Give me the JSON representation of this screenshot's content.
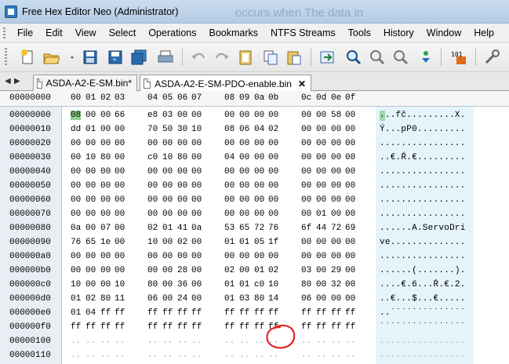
{
  "window": {
    "title": "Free Hex Editor Neo (Administrator)",
    "background_text": "occurs when          The data in"
  },
  "menu": [
    "File",
    "Edit",
    "View",
    "Select",
    "Operations",
    "Bookmarks",
    "NTFS Streams",
    "Tools",
    "History",
    "Window",
    "Help"
  ],
  "toolbar": {
    "icons": [
      "new-file-icon",
      "open-folder-icon",
      "dropdown-arrow-icon",
      "save-icon",
      "save-as-icon",
      "save-all-icon",
      "print-icon",
      "undo-icon",
      "redo-icon",
      "clipboard-icon",
      "copy-icon",
      "paste-icon",
      "go-to-icon",
      "find-icon",
      "find-next-icon",
      "find-prev-icon",
      "replace-icon",
      "encoding-icon",
      "tools-icon"
    ]
  },
  "tabs": [
    {
      "label": "ASDA-A2-E-SM.bin*",
      "active": false
    },
    {
      "label": "ASDA-A2-E-SM-PDO-enable.bin",
      "active": true
    }
  ],
  "hex": {
    "corner": "00000000",
    "columns": [
      "00",
      "01",
      "02",
      "03",
      "04",
      "05",
      "06",
      "07",
      "08",
      "09",
      "0a",
      "0b",
      "0c",
      "0d",
      "0e",
      "0f"
    ],
    "rows": [
      {
        "offset": "00000000",
        "bytes": [
          "08",
          "00",
          "00",
          "66",
          "e8",
          "03",
          "00",
          "00",
          "00",
          "00",
          "00",
          "00",
          "00",
          "00",
          "58",
          "00"
        ],
        "ascii": "...fč.........X."
      },
      {
        "offset": "00000010",
        "bytes": [
          "dd",
          "01",
          "00",
          "00",
          "70",
          "50",
          "30",
          "10",
          "08",
          "06",
          "04",
          "02",
          "00",
          "00",
          "00",
          "00"
        ],
        "ascii": "Ý...pP0........."
      },
      {
        "offset": "00000020",
        "bytes": [
          "00",
          "00",
          "00",
          "00",
          "00",
          "00",
          "00",
          "00",
          "00",
          "00",
          "00",
          "00",
          "00",
          "00",
          "00",
          "00"
        ],
        "ascii": "................"
      },
      {
        "offset": "00000030",
        "bytes": [
          "00",
          "10",
          "80",
          "00",
          "c0",
          "10",
          "80",
          "00",
          "04",
          "00",
          "00",
          "00",
          "00",
          "00",
          "00",
          "00"
        ],
        "ascii": "..€.Ŕ.€........."
      },
      {
        "offset": "00000040",
        "bytes": [
          "00",
          "00",
          "00",
          "00",
          "00",
          "00",
          "00",
          "00",
          "00",
          "00",
          "00",
          "00",
          "00",
          "00",
          "00",
          "00"
        ],
        "ascii": "................"
      },
      {
        "offset": "00000050",
        "bytes": [
          "00",
          "00",
          "00",
          "00",
          "00",
          "00",
          "00",
          "00",
          "00",
          "00",
          "00",
          "00",
          "00",
          "00",
          "00",
          "00"
        ],
        "ascii": "................"
      },
      {
        "offset": "00000060",
        "bytes": [
          "00",
          "00",
          "00",
          "00",
          "00",
          "00",
          "00",
          "00",
          "00",
          "00",
          "00",
          "00",
          "00",
          "00",
          "00",
          "00"
        ],
        "ascii": "................"
      },
      {
        "offset": "00000070",
        "bytes": [
          "00",
          "00",
          "00",
          "00",
          "00",
          "00",
          "00",
          "00",
          "00",
          "00",
          "00",
          "00",
          "00",
          "01",
          "00",
          "00"
        ],
        "ascii": "................"
      },
      {
        "offset": "00000080",
        "bytes": [
          "0a",
          "00",
          "07",
          "00",
          "02",
          "01",
          "41",
          "0a",
          "53",
          "65",
          "72",
          "76",
          "6f",
          "44",
          "72",
          "69"
        ],
        "ascii": "......A.ServoDri"
      },
      {
        "offset": "00000090",
        "bytes": [
          "76",
          "65",
          "1e",
          "00",
          "10",
          "00",
          "02",
          "00",
          "01",
          "01",
          "05",
          "1f",
          "00",
          "00",
          "00",
          "00"
        ],
        "ascii": "ve.............."
      },
      {
        "offset": "000000a0",
        "bytes": [
          "00",
          "00",
          "00",
          "00",
          "00",
          "00",
          "00",
          "00",
          "00",
          "00",
          "00",
          "00",
          "00",
          "00",
          "00",
          "00"
        ],
        "ascii": "................"
      },
      {
        "offset": "000000b0",
        "bytes": [
          "00",
          "00",
          "00",
          "00",
          "00",
          "00",
          "28",
          "00",
          "02",
          "00",
          "01",
          "02",
          "03",
          "00",
          "29",
          "00"
        ],
        "ascii": "......(.......)."
      },
      {
        "offset": "000000c0",
        "bytes": [
          "10",
          "00",
          "00",
          "10",
          "80",
          "00",
          "36",
          "00",
          "01",
          "01",
          "c0",
          "10",
          "80",
          "00",
          "32",
          "00"
        ],
        "ascii": "....€.6...Ŕ.€.2."
      },
      {
        "offset": "000000d0",
        "bytes": [
          "01",
          "02",
          "80",
          "11",
          "06",
          "00",
          "24",
          "00",
          "01",
          "03",
          "80",
          "14",
          "06",
          "00",
          "00",
          "00"
        ],
        "ascii": "..€...$...€....."
      },
      {
        "offset": "000000e0",
        "bytes": [
          "01",
          "04",
          "ff",
          "ff",
          "ff",
          "ff",
          "ff",
          "ff",
          "ff",
          "ff",
          "ff",
          "ff",
          "ff",
          "ff",
          "ff",
          "ff"
        ],
        "ascii": "..˙˙˙˙˙˙˙˙˙˙˙˙˙˙"
      },
      {
        "offset": "000000f0",
        "bytes": [
          "ff",
          "ff",
          "ff",
          "ff",
          "ff",
          "ff",
          "ff",
          "ff",
          "ff",
          "ff",
          "ff",
          "ff",
          "ff",
          "ff",
          "ff",
          "ff"
        ],
        "ascii": "˙˙˙˙˙˙˙˙˙˙˙˙˙˙˙˙"
      },
      {
        "offset": "00000100",
        "bytes": [
          "..",
          "..",
          "..",
          "..",
          "..",
          "..",
          "..",
          "..",
          "..",
          "..",
          "..",
          "..",
          "..",
          "..",
          "..",
          ".."
        ],
        "ascii": "................",
        "dim": true
      },
      {
        "offset": "00000110",
        "bytes": [
          "..",
          "..",
          "..",
          "..",
          "..",
          "..",
          "..",
          "..",
          "..",
          "..",
          "..",
          "..",
          "..",
          "..",
          "..",
          ".."
        ],
        "ascii": "................",
        "dim": true
      }
    ],
    "selected": {
      "row": 0,
      "col": 0
    },
    "highlight_color": "#e2262a"
  }
}
